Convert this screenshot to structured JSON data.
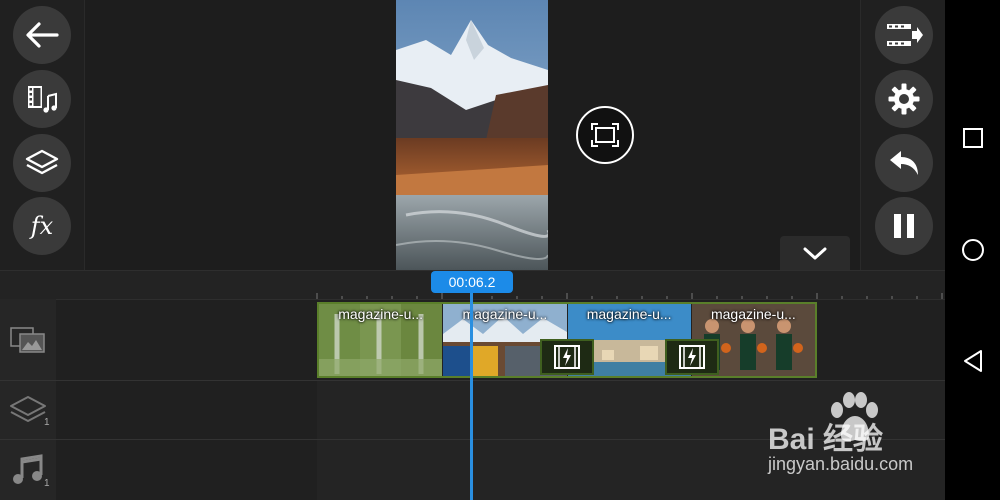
{
  "left_toolbar": {
    "buttons": [
      {
        "name": "back-button",
        "icon": "arrow-left-icon"
      },
      {
        "name": "media-audio-button",
        "icon": "film-music-icon"
      },
      {
        "name": "layers-button",
        "icon": "layers-icon"
      },
      {
        "name": "fx-button",
        "icon": "fx-icon",
        "label": "fx"
      }
    ]
  },
  "right_toolbar": {
    "buttons": [
      {
        "name": "export-button",
        "icon": "film-export-icon"
      },
      {
        "name": "settings-button",
        "icon": "gear-icon"
      },
      {
        "name": "undo-button",
        "icon": "undo-icon"
      },
      {
        "name": "pause-button",
        "icon": "pause-icon"
      }
    ]
  },
  "preview": {
    "fullscreen_icon": "fullscreen-icon",
    "collapse_icon": "chevron-down-icon"
  },
  "timeline": {
    "playhead_time": "00:06.2",
    "clips": [
      {
        "label": "magazine-u..."
      },
      {
        "label": "magazine-u..."
      },
      {
        "label": "magazine-u..."
      },
      {
        "label": "magazine-u..."
      }
    ],
    "tracks": [
      {
        "icon": "video-track-icon",
        "count": ""
      },
      {
        "icon": "layer-track-icon",
        "count": "1"
      },
      {
        "icon": "audio-track-icon",
        "count": "1"
      }
    ],
    "transition_icon": "transition-icon"
  },
  "system_nav": {
    "recent": "square-icon",
    "home": "circle-icon",
    "back": "triangle-back-icon"
  },
  "watermark": {
    "title": "Bai 经验",
    "url": "jingyan.baidu.com"
  },
  "colors": {
    "accent_blue": "#1c8be8",
    "clip_border": "#5a7f2a"
  }
}
